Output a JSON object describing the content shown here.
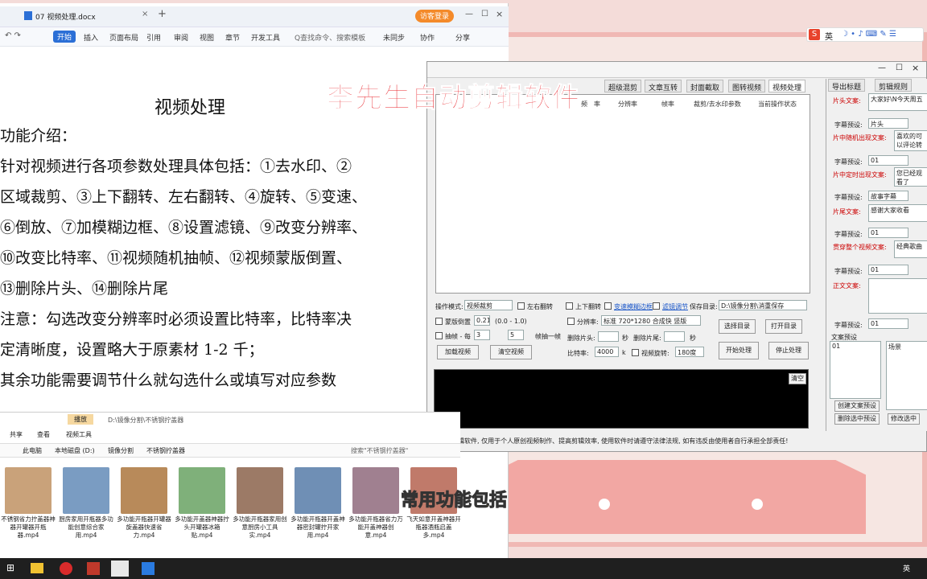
{
  "wps": {
    "tab_title": "07 视频处理.docx",
    "login_label": "访客登录",
    "menu": [
      "开始",
      "插入",
      "页面布局",
      "引用",
      "审阅",
      "视图",
      "章节",
      "开发工具"
    ],
    "search_placeholder": "Q查找命令、搜索模板",
    "sync": "未同步",
    "collab": "协作",
    "share": "分享"
  },
  "doc": {
    "title": "视频处理",
    "lines": [
      "功能介绍：",
      "针对视频进行各项参数处理具体包括：①去水印、②",
      "区域裁剪、③上下翻转、左右翻转、④旋转、⑤变速、",
      "⑥倒放、⑦加模糊边框、⑧设置滤镜、⑨改变分辨率、",
      "⑩改变比特率、⑪视频随机抽帧、⑫视频蒙版倒置、",
      "⑬删除片头、⑭删除片尾",
      "注意：勾选改变分辨率时必须设置比特率，比特率决",
      "定清晰度，设置略大于原素材 1-2 千；",
      "其余功能需要调节什么就勾选什么或填写对应参数"
    ]
  },
  "overlay_title": "李先生自动剪辑软件",
  "tool": {
    "tabs": [
      "超级混剪",
      "文章互转",
      "封面截取",
      "图转视频",
      "视频处理"
    ],
    "grid_cols": [
      "频",
      "率",
      "分辨率",
      "帧率",
      "裁剪/去水印参数",
      "当前操作状态"
    ],
    "op_mode_label": "操作模式:",
    "op_mode_value": "视频裁剪",
    "lr_flip": "左右翻转",
    "ud_flip": "上下翻转",
    "blur_frame": "变速模糊边框",
    "filter": "滤镜调节",
    "save_dir_label": "保存目录:",
    "save_dir_value": "D:\\镜像分割\\消重保存",
    "mask_label": "蒙版倒置",
    "mask_value": "0.21",
    "mask_range": "(0.0 - 1.0)",
    "resolution_label": "分辨率:",
    "resolution_value": "标准 720*1280 合成快 竖版",
    "frame_label": "抽帧 - 每",
    "frame_a": "3",
    "frame_b": "5",
    "frame_suffix": "帧抽一帧",
    "cut_head": "删除片头:",
    "cut_tail": "删除片尾:",
    "sec": "秒",
    "bitrate_label": "比特率:",
    "bitrate_value": "4000",
    "bitrate_unit": "k",
    "rotate_label": "视频旋转:",
    "rotate_value": "180度",
    "btn_load": "加载视频",
    "btn_clear": "清空视频",
    "btn_select_dir": "选择目录",
    "btn_open_dir": "打开目录",
    "btn_start": "开始处理",
    "btn_stop": "停止处理",
    "console_clear": "清空",
    "footer": "全自动剪辑软件, 仅用于个人原创视频制作、提高剪辑效率, 使用软件时请遵守法律法规, 如有违反由使用者自行承担全部责任!"
  },
  "right_panel": {
    "tabs": [
      "导出标题",
      "剪辑规则"
    ],
    "head_text_label": "片头文案:",
    "head_text_value": "大家好\\N今天周五",
    "sub_preset": "字幕预设:",
    "sub_preset_1": "片头",
    "random_label": "片中随机出现文案:",
    "random_value": "喜欢的可以评论转发,",
    "sub_preset_2": "01",
    "fixed_label": "片中定时出现文案:",
    "fixed_value": "您已经观看了",
    "sub_preset_3": "故事字幕",
    "tail_label": "片尾文案:",
    "tail_value": "感谢大家收看",
    "sub_preset_4": "01",
    "through_label": "贯穿整个视频文案:",
    "through_value": "经典歌曲",
    "sub_preset_5": "01",
    "body_label": "正文文案:",
    "sub_preset_6": "01",
    "preset_label": "文案预设",
    "preset_item": "01",
    "scene": "场景",
    "btn_create": "创建文案预设",
    "btn_delete": "删除选中预设",
    "btn_modify": "修改选中"
  },
  "explorer": {
    "ribbon_tab": "播放",
    "path_title": "D:\\镜像分割\\不锈钢拧盖器",
    "menu": [
      "共享",
      "查看",
      "视频工具"
    ],
    "crumbs": [
      "此电脑",
      "本地磁盘 (D:)",
      "镜像分割",
      "不锈钢拧盖器"
    ],
    "search": "搜索\"不锈钢拧盖器\"",
    "files": [
      "不锈钢省力拧盖器神器开罐器开瓶器.mp4",
      "厨房家用开瓶器多功能创意综合家用.mp4",
      "多功能开瓶器开罐器旋盖器快速省力.mp4",
      "多功能开盖器神器拧头开罐器冰箱贴.mp4",
      "多功能开瓶器家用创意厨房小工具实.mp4",
      "多功能开瓶器开盖神器密封罐拧开家用.mp4",
      "多功能开瓶器省力万能开盖神器创意.mp4",
      "飞天如意开盖神器开瓶器酒瓶启盖多.mp4"
    ],
    "thumb_colors": [
      "#c9a27a",
      "#7a9cc2",
      "#b88a5a",
      "#7fb07a",
      "#9c7a66",
      "#6f8fb5",
      "#a08090",
      "#c07a6a"
    ]
  },
  "caption": "常用功能包括",
  "sogou": "英"
}
